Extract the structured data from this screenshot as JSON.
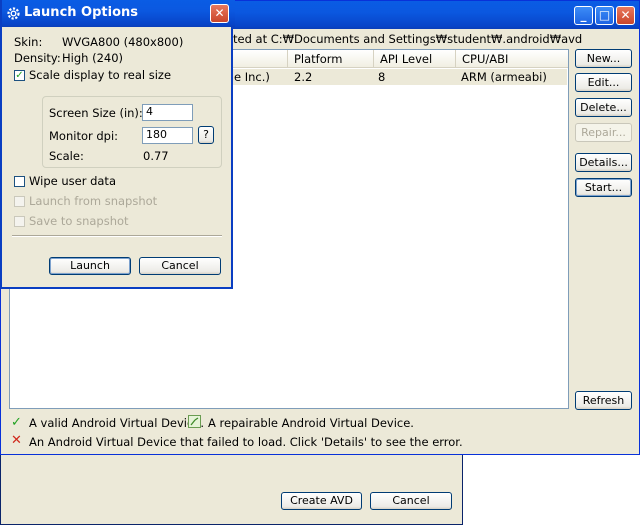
{
  "create_avd_dialog": {
    "create_label": "Create AVD",
    "cancel_label": "Cancel"
  },
  "avd_window": {
    "path_text": "ted at C:₩Documents and Settings₩student₩.android₩avd",
    "columns": [
      "Platform",
      "API Level",
      "CPU/ABI"
    ],
    "row": {
      "name_fragment": "e Inc.)",
      "platform": "2.2",
      "api_level": "8",
      "cpu_abi": "ARM (armeabi)"
    },
    "buttons": {
      "new": "New...",
      "edit": "Edit...",
      "delete": "Delete...",
      "repair": "Repair...",
      "details": "Details...",
      "start": "Start...",
      "refresh": "Refresh"
    },
    "legend": {
      "valid": "A valid Android Virtual Device.",
      "repairable": "A repairable Android Virtual Device.",
      "failed": "An Android Virtual Device that failed to load. Click 'Details' to see the error."
    }
  },
  "launch_dialog": {
    "title": "Launch Options",
    "skin_label": "Skin:",
    "skin_value": "WVGA800 (480x800)",
    "density_label": "Density:",
    "density_value": "High (240)",
    "scale_display_label": "Scale display to real size",
    "scale_display_checked": true,
    "screen_size_label": "Screen Size (in):",
    "screen_size_value": "4",
    "monitor_dpi_label": "Monitor dpi:",
    "monitor_dpi_value": "180",
    "help_label": "?",
    "scale_label": "Scale:",
    "scale_value": "0.77",
    "wipe_label": "Wipe user data",
    "wipe_checked": false,
    "snapshot_launch_label": "Launch from snapshot",
    "snapshot_save_label": "Save to snapshot",
    "launch_label": "Launch",
    "cancel_label": "Cancel"
  },
  "colors": {
    "titlebar_blue": "#0a5ce4",
    "dialog_face": "#ece9d8",
    "check_green": "#21a121",
    "error_red": "#d0271a"
  }
}
